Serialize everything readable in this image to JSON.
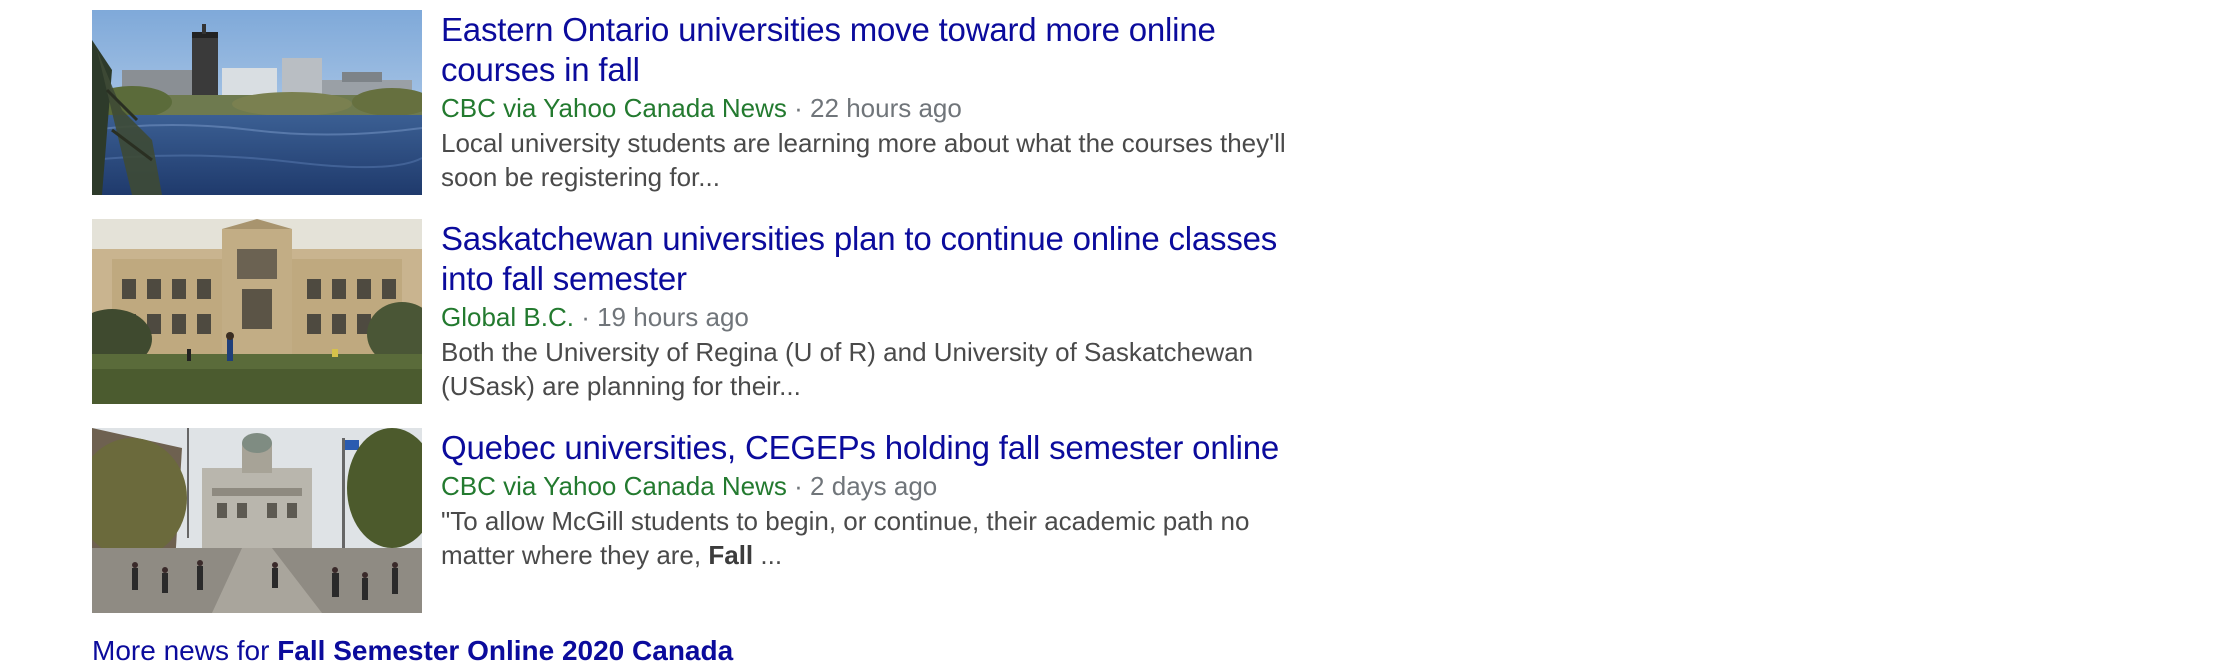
{
  "news": [
    {
      "headline": "Eastern Ontario universities move toward more online courses in fall",
      "source": "CBC via Yahoo Canada News",
      "separator": "·",
      "time": "22 hours ago",
      "snippet": "Local university students are learning more about what the courses they'll soon be registering for...",
      "snippet_bold": "",
      "snippet_tail": ""
    },
    {
      "headline": "Saskatchewan universities plan to continue online classes into fall semester",
      "source": "Global B.C.",
      "separator": "·",
      "time": "19 hours ago",
      "snippet": "Both the University of Regina (U of R) and University of Saskatchewan (USask) are planning for their...",
      "snippet_bold": "",
      "snippet_tail": ""
    },
    {
      "headline": "Quebec universities, CEGEPs holding fall semester online",
      "source": "CBC via Yahoo Canada News",
      "separator": "·",
      "time": "2 days ago",
      "snippet": "\"To allow McGill students to begin, or continue, their academic path no matter where they are,",
      "snippet_bold": "Fall",
      "snippet_tail": "..."
    }
  ],
  "more_news": {
    "prefix": "More news for",
    "query": "Fall Semester Online 2020 Canada"
  },
  "colors": {
    "link": "#0b0b9c",
    "source": "#237a2f",
    "time": "#70757a",
    "snippet": "#4a4a4a"
  }
}
